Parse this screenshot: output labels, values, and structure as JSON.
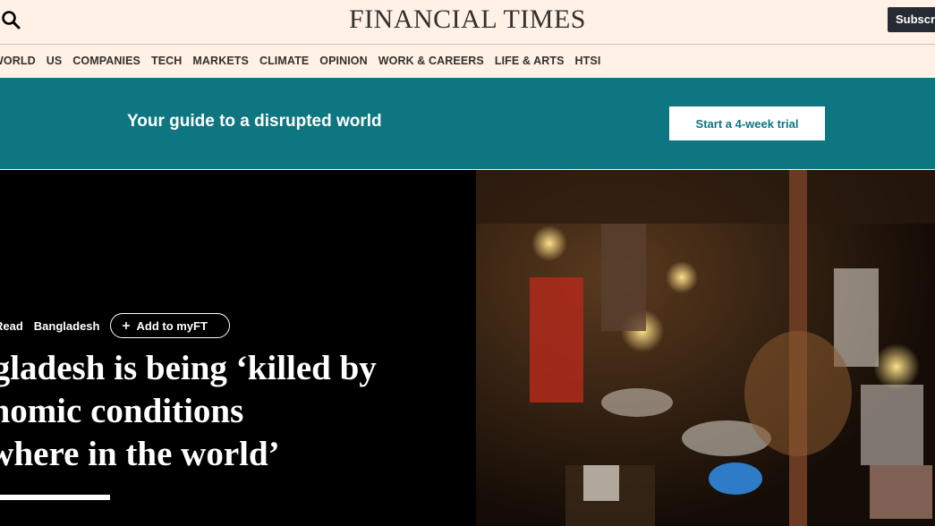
{
  "header": {
    "masthead": "FINANCIAL TIMES",
    "subscribe_label": "Subscribe"
  },
  "nav": {
    "items": [
      "WORLD",
      "US",
      "COMPANIES",
      "TECH",
      "MARKETS",
      "CLIMATE",
      "OPINION",
      "WORK & CAREERS",
      "LIFE & ARTS",
      "HTSI"
    ]
  },
  "promo": {
    "text": "Your guide to a disrupted world",
    "button_label": "Start a 4-week trial",
    "bg_color": "#0d7680"
  },
  "hero": {
    "tag_1": "Read",
    "tag_2": "Bangladesh",
    "add_label": "Add to myFT",
    "headline_1": "ngladesh is being ‘killed by",
    "headline_2": "onomic conditions",
    "headline_3": "ewhere in the world’"
  }
}
